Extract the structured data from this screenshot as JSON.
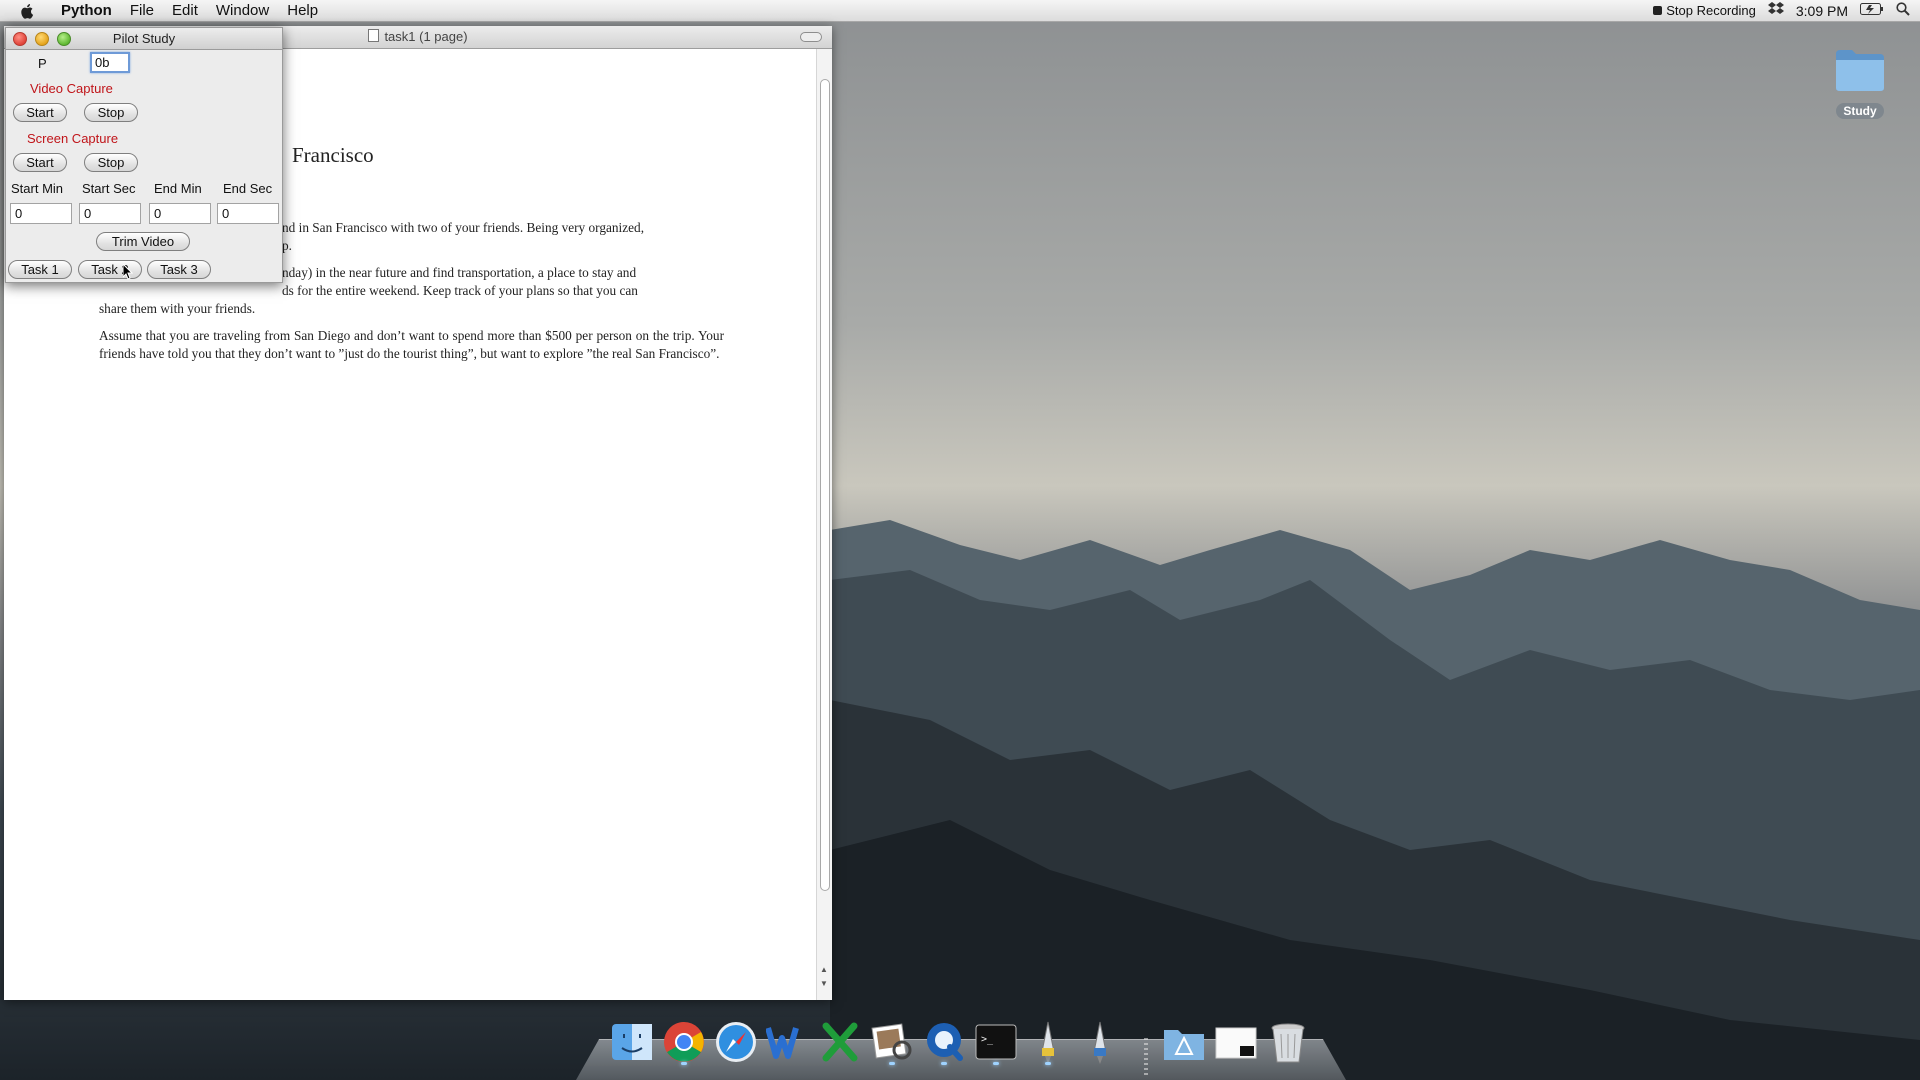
{
  "menubar": {
    "app": "Python",
    "menus": [
      "File",
      "Edit",
      "Window",
      "Help"
    ],
    "status": {
      "recording": "Stop Recording",
      "time": "3:09 PM"
    }
  },
  "doc_window": {
    "title": "task1 (1 page)",
    "heading_fragment": "Francisco",
    "p1_line1": "nd in San Francisco with two of your friends.  Being very organized,",
    "p1_line2": "p.",
    "p2_line1": "nday) in the near future and find transportation, a place to stay and",
    "p2_line2": "ds for the entire weekend.  Keep track of your plans so that you can",
    "p2_line3": "share them with your friends.",
    "p3": "Assume that you are traveling from San Diego and don’t want to spend more than $500 per person on the trip.  Your friends have told you that they don’t want to ”just do the tourist thing”, but want to explore ”the real San Francisco”."
  },
  "pilot": {
    "title": "Pilot Study",
    "p_label": "P",
    "p_value": "0b",
    "video_capture": "Video Capture",
    "screen_capture": "Screen Capture",
    "start": "Start",
    "stop": "Stop",
    "start_min_label": "Start Min",
    "start_sec_label": "Start Sec",
    "end_min_label": "End Min",
    "end_sec_label": "End Sec",
    "start_min": "0",
    "start_sec": "0",
    "end_min": "0",
    "end_sec": "0",
    "trim_video": "Trim Video",
    "task1": "Task 1",
    "task2": "Task 2",
    "task3": "Task 3"
  },
  "desktop": {
    "folder_label": "Study"
  },
  "dock": {
    "icons": [
      "finder-icon",
      "chrome-icon",
      "safari-icon",
      "word-icon",
      "excel-icon",
      "preview-icon",
      "quicktime-icon",
      "terminal-icon",
      "python-launcher-icon",
      "python-launcher-2-icon",
      "applications-folder-icon",
      "window-minimized-icon",
      "trash-icon"
    ]
  }
}
